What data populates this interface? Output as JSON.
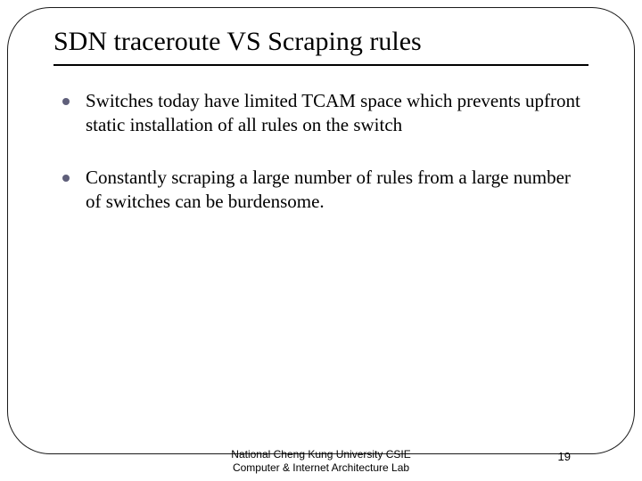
{
  "title": "SDN traceroute VS Scraping rules",
  "bullets": [
    {
      "text": "Switches today have limited TCAM space which prevents upfront static installation of all rules on the switch"
    },
    {
      "text": "Constantly scraping a large number of rules from a large number of switches can be burdensome."
    }
  ],
  "footer": {
    "line1": "National Cheng Kung University CSIE",
    "line2": "Computer & Internet Architecture Lab"
  },
  "page_number": "19"
}
